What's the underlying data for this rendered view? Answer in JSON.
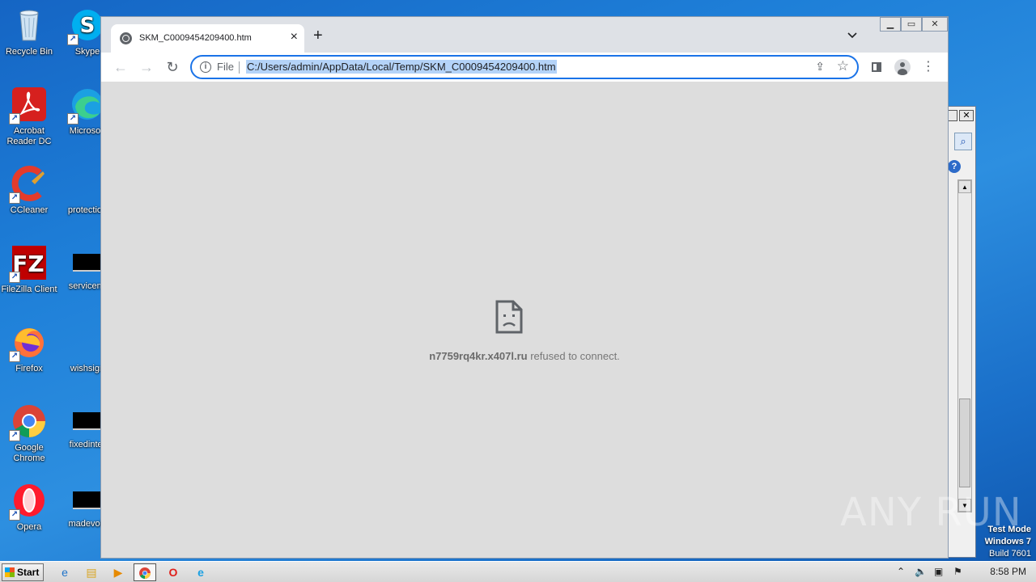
{
  "desktop": {
    "icons": [
      {
        "label": "Recycle Bin"
      },
      {
        "label": "Skype"
      },
      {
        "label": "Acrobat Reader DC"
      },
      {
        "label": "Microsoft"
      },
      {
        "label": "CCleaner"
      },
      {
        "label": "protection"
      },
      {
        "label": "FileZilla Client"
      },
      {
        "label": "servicemi"
      },
      {
        "label": "Firefox"
      },
      {
        "label": "wishsign"
      },
      {
        "label": "Google Chrome"
      },
      {
        "label": "fixedinter"
      },
      {
        "label": "Opera"
      },
      {
        "label": "madevoic"
      }
    ],
    "watermark": "ANY RUN",
    "test_mode": {
      "line1": "Test Mode",
      "line2": "Windows 7",
      "line3": "Build 7601"
    }
  },
  "browser": {
    "tab_title": "SKM_C0009454209400.htm",
    "tab_close": "×",
    "new_tab": "+",
    "omnibox": {
      "scheme_label": "File",
      "url": "C:/Users/admin/AppData/Local/Temp/SKM_C0009454209400.htm"
    },
    "error": {
      "host": "n7759rq4kr.x407l.ru",
      "message": " refused to connect."
    }
  },
  "taskbar": {
    "start_label": "Start",
    "clock": "8:58 PM"
  }
}
